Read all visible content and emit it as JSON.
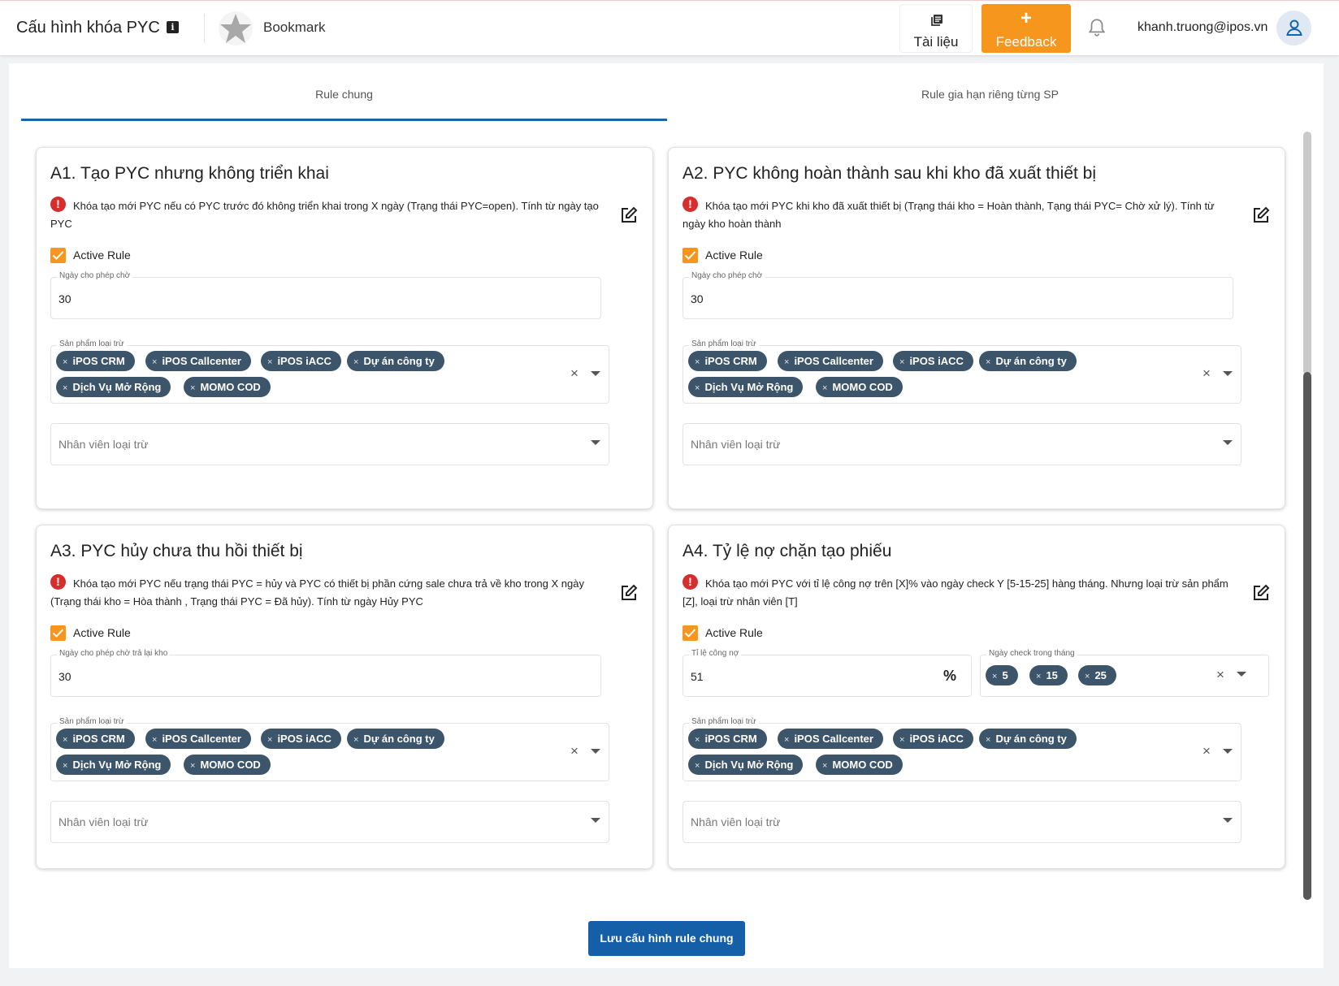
{
  "header": {
    "title": "Cấu hình khóa PYC",
    "info_icon": "i",
    "bookmark_label": "Bookmark",
    "docs_label": "Tài liệu",
    "feedback_plus": "+",
    "feedback_label": "Feedback",
    "user_email": "khanh.truong@ipos.vn"
  },
  "tabs": [
    {
      "label": "Rule chung",
      "active": true
    },
    {
      "label": "Rule gia hạn riêng từng SP",
      "active": false
    }
  ],
  "common": {
    "active_label": "Active Rule",
    "products_label": "Sản phẩm loại trừ",
    "staff_placeholder": "Nhân viên loại trừ",
    "warn_glyph": "!",
    "clear_glyph": "×",
    "chip_remove_glyph": "×"
  },
  "products": [
    "iPOS CRM",
    "iPOS Callcenter",
    "iPOS iACC",
    "Dự án công ty",
    "Dịch Vụ Mở Rộng",
    "MOMO COD"
  ],
  "cards": {
    "a1": {
      "title": "A1. Tạo PYC nhưng không triển khai",
      "desc": "Khóa tạo mới PYC nếu có PYC trước đó không triển khai trong X ngày (Trạng thái PYC=open). Tính từ ngày tạo PYC",
      "field_label": "Ngày cho phép chờ",
      "field_value": "30"
    },
    "a2": {
      "title": "A2. PYC không hoàn thành sau khi kho đã xuất thiết bị",
      "desc": "Khóa tạo mới PYC khi kho đã xuất thiết bị (Trạng thái kho = Hoàn thành, Tạng thái PYC= Chờ xử lý). Tính từ ngày kho hoàn thành",
      "field_label": "Ngày cho phép chờ",
      "field_value": "30"
    },
    "a3": {
      "title": "A3. PYC hủy chưa thu hồi thiết bị",
      "desc": "Khóa tạo mới PYC nếu trạng thái PYC = hủy và PYC có thiết bị phần cứng sale chưa trả về kho trong X ngày (Trạng thái kho = Hòa thành , Trạng thái PYC = Đã hủy). Tính từ ngày Hủy PYC",
      "field_label": "Ngày cho phép chờ trả lại kho",
      "field_value": "30"
    },
    "a4": {
      "title": "A4. Tỷ lệ nợ chặn tạo phiếu",
      "desc": "Khóa tạo mới PYC với tỉ lệ công nợ trên [X]% vào ngày check Y [5-15-25] hàng tháng. Nhưng loại trừ sản phẩm [Z], loại trừ nhân viên [T]",
      "debt_label": "Tỉ lệ công nợ",
      "debt_value": "51",
      "pct_glyph": "%",
      "days_label": "Ngày check trong tháng",
      "days": [
        "5",
        "15",
        "25"
      ]
    }
  },
  "save_label": "Lưu cấu hình rule chung",
  "colors": {
    "accent_orange": "#f7961d",
    "primary_blue": "#155ea8",
    "chip_bg": "#3d556a",
    "warn_red": "#d32f2f"
  },
  "icons": {
    "info": "info-icon",
    "bookmark": "star-icon",
    "docs": "documents-icon",
    "bell": "bell-icon",
    "avatar": "user-icon",
    "edit": "edit-icon",
    "warning": "warning-icon",
    "checkbox": "checkbox-icon",
    "percent": "percent-icon",
    "caret": "chevron-down-icon"
  }
}
